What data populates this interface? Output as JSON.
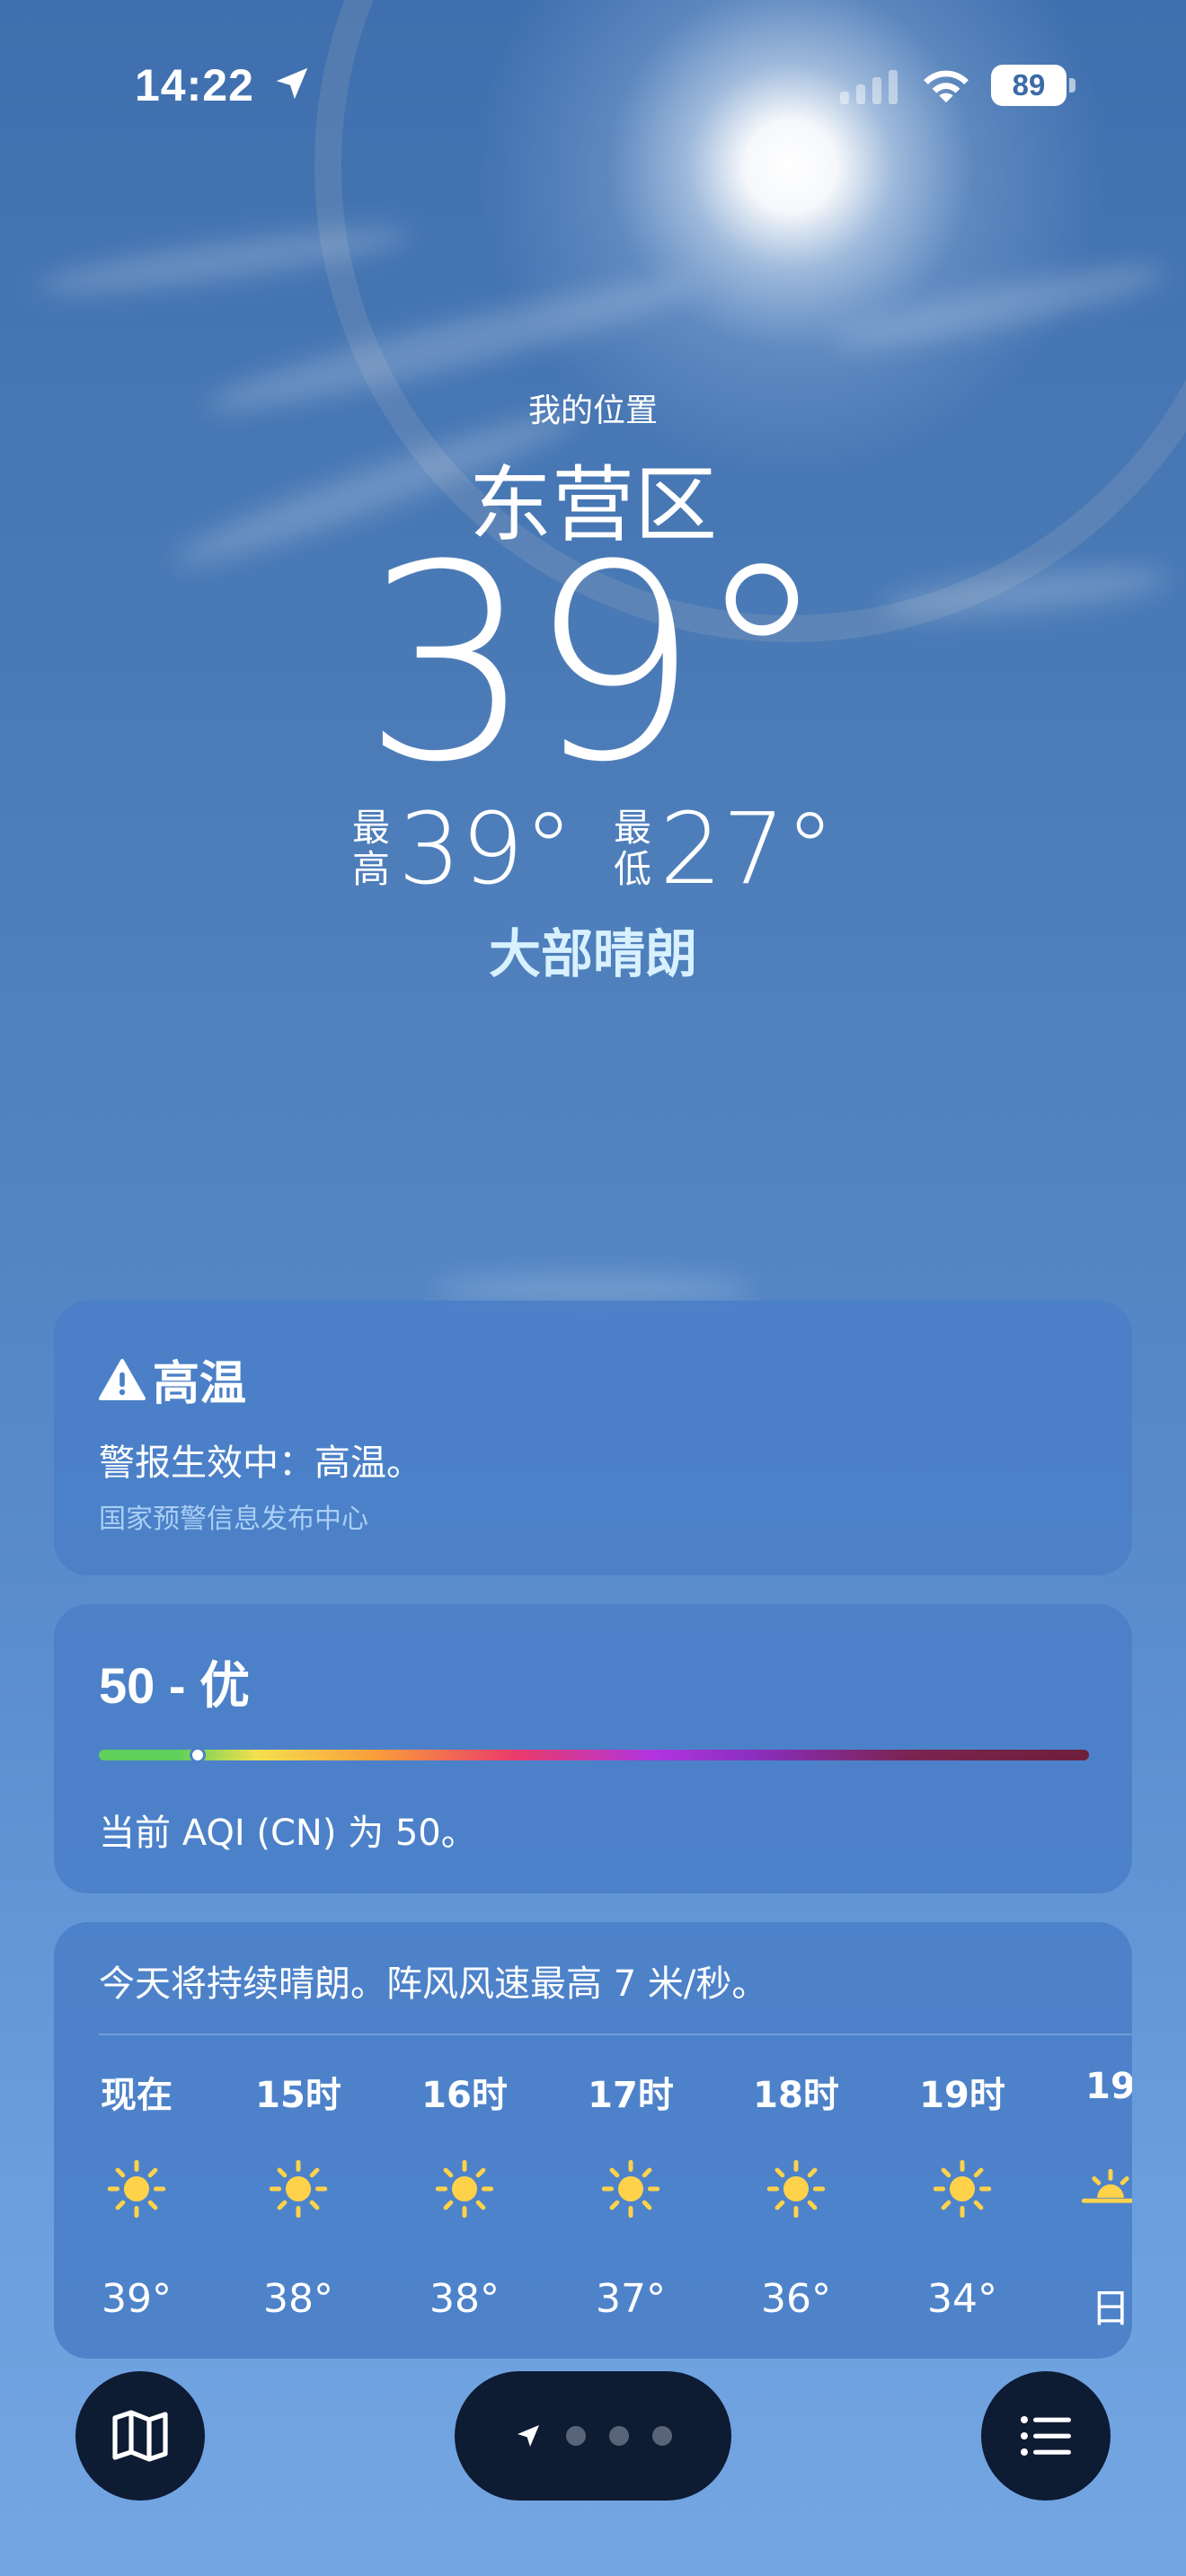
{
  "status_bar": {
    "time": "14:22",
    "battery": "89"
  },
  "header": {
    "location_label": "我的位置",
    "city": "东营区",
    "temperature": "39°",
    "high_label": "最高",
    "high": "39°",
    "low_label": "最低",
    "low": "27°",
    "condition": "大部晴朗"
  },
  "alert": {
    "title": "高温",
    "body": "警报生效中：高温。",
    "source": "国家预警信息发布中心",
    "icon": "warning-icon"
  },
  "aqi": {
    "title": "50 - 优",
    "value": 50,
    "description": "当前 AQI (CN) 为 50。"
  },
  "forecast": {
    "summary": "今天将持续晴朗。阵风风速最高 7 米/秒。",
    "hours": [
      {
        "label": "现在",
        "icon": "sun-icon",
        "temp": "39°"
      },
      {
        "label": "15时",
        "icon": "sun-icon",
        "temp": "38°"
      },
      {
        "label": "16时",
        "icon": "sun-icon",
        "temp": "38°"
      },
      {
        "label": "17时",
        "icon": "sun-icon",
        "temp": "37°"
      },
      {
        "label": "18时",
        "icon": "sun-icon",
        "temp": "36°"
      },
      {
        "label": "19时",
        "icon": "sun-icon",
        "temp": "34°"
      },
      {
        "label": "19",
        "icon": "sunset-icon",
        "temp": "日"
      }
    ]
  },
  "toolbar": {
    "map_icon": "map-icon",
    "list_icon": "list-icon",
    "pages": 3
  },
  "colors": {
    "card": "#4a80c8",
    "sun": "#ffd24a",
    "condition": "#d8f1ff",
    "toolbar": "#0d1b33"
  }
}
